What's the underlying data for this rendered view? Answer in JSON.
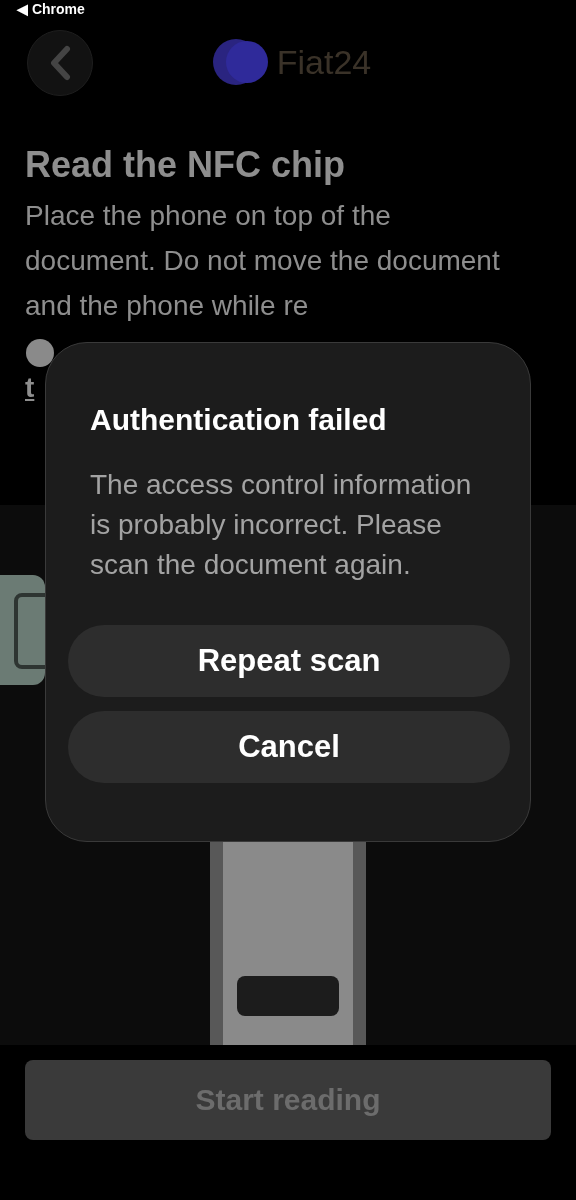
{
  "status_bar": {
    "back_label": "◀ Chrome"
  },
  "header": {
    "brand": "Fiat24"
  },
  "title": "Read the NFC chip",
  "instructions": "Place the phone on top of the document. Do not move the document and the phone while re",
  "help_link": "t",
  "dialog": {
    "title": "Authentication failed",
    "message": "The access control information is probably incorrect. Please scan the document again.",
    "buttons": [
      "Repeat scan",
      "Cancel"
    ]
  },
  "primary_button": {
    "label": "Start reading",
    "disabled": true
  }
}
